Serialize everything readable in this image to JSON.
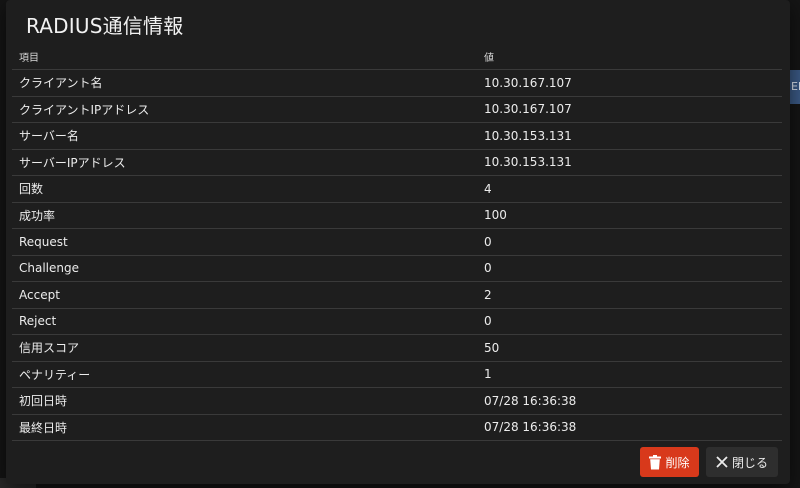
{
  "dialog": {
    "title": "RADIUS通信情報",
    "table": {
      "headers": [
        "項目",
        "値"
      ],
      "rows": [
        [
          "クライアント名",
          "10.30.167.107"
        ],
        [
          "クライアントIPアドレス",
          "10.30.167.107"
        ],
        [
          "サーバー名",
          "10.30.153.131"
        ],
        [
          "サーバーIPアドレス",
          "10.30.153.131"
        ],
        [
          "回数",
          "4"
        ],
        [
          "成功率",
          "100"
        ],
        [
          "Request",
          "0"
        ],
        [
          "Challenge",
          "0"
        ],
        [
          "Accept",
          "2"
        ],
        [
          "Reject",
          "0"
        ],
        [
          "信用スコア",
          "50"
        ],
        [
          "ペナリティー",
          "1"
        ],
        [
          "初回日時",
          "07/28 16:36:38"
        ],
        [
          "最終日時",
          "07/28 16:36:38"
        ]
      ]
    },
    "buttons": {
      "delete_label": "削除",
      "close_label": "閉じる"
    },
    "icons": {
      "delete": "trash-icon",
      "close": "close-icon"
    }
  },
  "background": {
    "partial_button_text": "EI"
  },
  "colors": {
    "dialog_bg": "#1e1e1e",
    "delete_button": "#d8391b",
    "close_button": "#2e2e2e",
    "text": "#ececec",
    "row_divider": "#3a3a3a"
  }
}
